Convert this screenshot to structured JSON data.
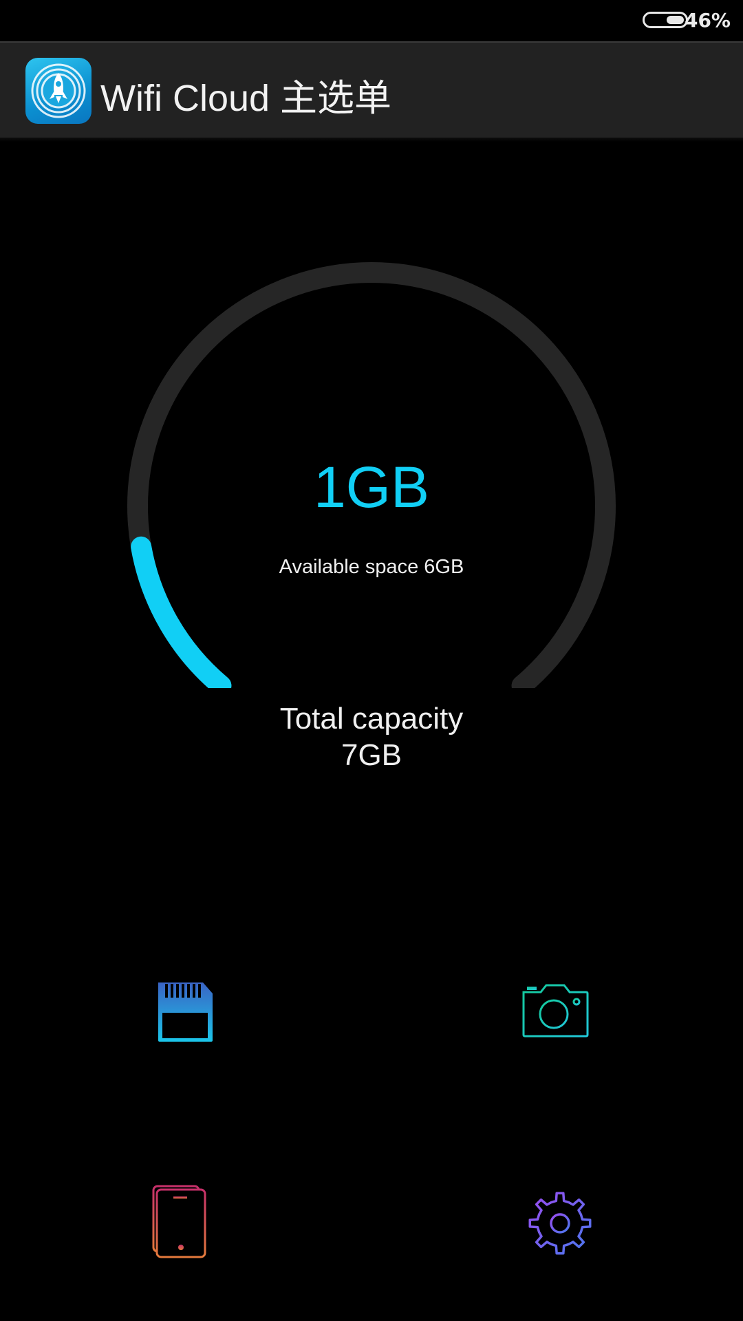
{
  "status_bar": {
    "battery_percent_label": "46%",
    "battery_level": 0.46
  },
  "app_bar": {
    "title": "Wifi Cloud 主选单",
    "icon": "rocket-icon"
  },
  "storage": {
    "used": "1GB",
    "available": "Available space 6GB",
    "total_label": "Total capacity",
    "total_value": "7GB",
    "used_fraction": 0.143,
    "track_color": "#262626",
    "progress_color": "#11cff5"
  },
  "menu": [
    {
      "name": "sd-card",
      "icon": "sd-card-icon"
    },
    {
      "name": "camera",
      "icon": "camera-icon"
    },
    {
      "name": "phone",
      "icon": "phone-icon"
    },
    {
      "name": "settings",
      "icon": "gear-icon"
    }
  ]
}
